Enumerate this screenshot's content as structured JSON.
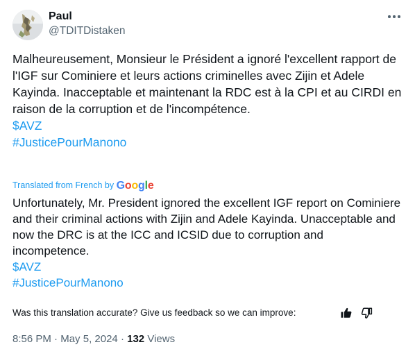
{
  "author": {
    "display_name": "Paul",
    "handle": "@TDITDistaken"
  },
  "tweet": {
    "original_text": "Malheureusement, Monsieur le Président a ignoré l'excellent rapport de l'IGF sur Cominiere et leurs actions criminelles avec Zijin et Adele Kayinda. Inacceptable et maintenant la RDC est à la CPI et au CIRDI en raison de la corruption et de l'incompétence.",
    "original_cashtag": "$AVZ",
    "original_hashtag": "#JusticePourManono",
    "translated_from": "Translated from French by",
    "translator_brand": "Google",
    "translation_text": "Unfortunately, Mr. President ignored the excellent IGF report on Cominiere and their criminal actions with Zijin and Adele Kayinda. Unacceptable and now the DRC is at the ICC and ICSID due to corruption and incompetence.",
    "translation_cashtag": "$AVZ",
    "translation_hashtag": "#JusticePourManono"
  },
  "feedback": {
    "question": "Was this translation accurate? Give us feedback so we can improve:",
    "thumbs_up_icon": "thumbs-up-icon",
    "thumbs_down_icon": "thumbs-down-icon"
  },
  "meta": {
    "time": "8:56 PM",
    "separator": "·",
    "date": "May 5, 2024",
    "views_count": "132",
    "views_label": "Views"
  },
  "colors": {
    "link": "#1d9bf0",
    "secondary_text": "#536471",
    "primary_text": "#0f1419"
  }
}
